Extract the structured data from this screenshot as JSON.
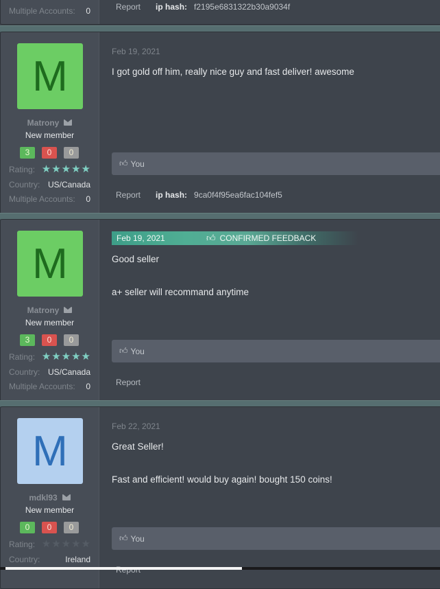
{
  "top_partial": {
    "multiple_accounts_label": "Multiple Accounts:",
    "multiple_accounts_value": "0",
    "report_label": "Report",
    "ip_hash_label": "ip hash:",
    "ip_hash_value": "f2195e6831322b30a9034f"
  },
  "posts": [
    {
      "avatar_letter": "M",
      "avatar_bg": "#6ccd64",
      "avatar_fg": "#1e6b1e",
      "username": "Matrony",
      "user_title": "New member",
      "feedback": {
        "positive": "3",
        "negative": "0",
        "neutral": "0"
      },
      "rating_label": "Rating:",
      "rating_stars": 5,
      "country_label": "Country:",
      "country": "US/Canada",
      "multiple_accounts_label": "Multiple Accounts:",
      "multiple_accounts": "0",
      "date": "Feb 19, 2021",
      "confirmed": false,
      "message_lines": [
        "I got gold off him, really nice guy and fast deliver! awesome"
      ],
      "like_label": "You",
      "report_label": "Report",
      "ip_hash_label": "ip hash:",
      "ip_hash_value": "9ca0f4f95ea6fac104fef5"
    },
    {
      "avatar_letter": "M",
      "avatar_bg": "#6ccd64",
      "avatar_fg": "#1e6b1e",
      "username": "Matrony",
      "user_title": "New member",
      "feedback": {
        "positive": "3",
        "negative": "0",
        "neutral": "0"
      },
      "rating_label": "Rating:",
      "rating_stars": 5,
      "country_label": "Country:",
      "country": "US/Canada",
      "multiple_accounts_label": "Multiple Accounts:",
      "multiple_accounts": "0",
      "date": "Feb 19, 2021",
      "confirmed": true,
      "confirmed_label": "CONFIRMED FEEDBACK",
      "message_lines": [
        "Good seller",
        "a+ seller will recommand anytime"
      ],
      "like_label": "You",
      "report_label": "Report"
    },
    {
      "avatar_letter": "M",
      "avatar_bg": "#b4d0ef",
      "avatar_fg": "#2f6fb8",
      "username": "mdkl93",
      "user_title": "New member",
      "feedback": {
        "positive": "0",
        "negative": "0",
        "neutral": "0"
      },
      "rating_label": "Rating:",
      "rating_stars": 0,
      "country_label": "Country:",
      "country": "Ireland",
      "date": "Feb 22, 2021",
      "confirmed": false,
      "message_lines": [
        "Great Seller!",
        "Fast and efficient! would buy again! bought 150 coins!"
      ],
      "like_label": "You",
      "report_label": "Report"
    }
  ]
}
